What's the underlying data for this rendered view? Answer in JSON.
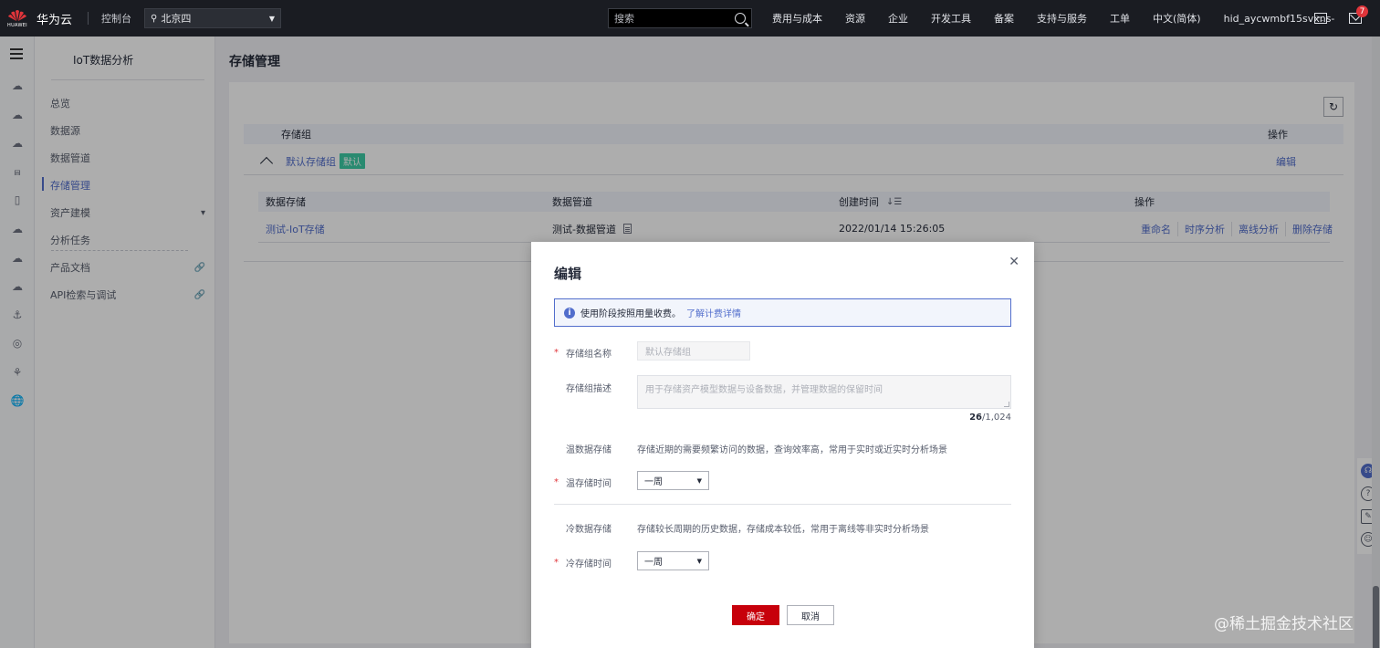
{
  "topbar": {
    "brand": "华为云",
    "logo_text": "HUAWEI",
    "console": "控制台",
    "region": "北京四",
    "search_placeholder": "搜索",
    "nav": [
      "费用与成本",
      "资源",
      "企业",
      "开发工具",
      "备案",
      "支持与服务",
      "工单",
      "中文(简体)",
      "hid_aycwmbf15svxns-"
    ],
    "mail_badge": "7"
  },
  "sidebar": {
    "title": "IoT数据分析",
    "items": [
      {
        "label": "总览"
      },
      {
        "label": "数据源"
      },
      {
        "label": "数据管道"
      },
      {
        "label": "存储管理",
        "active": true
      },
      {
        "label": "资产建模",
        "suffix": "▾"
      },
      {
        "label": "分析任务"
      },
      {
        "label": "产品文档",
        "suffix": "🔗"
      },
      {
        "label": "API检索与调试",
        "suffix": "🔗"
      }
    ]
  },
  "main": {
    "title": "存储管理",
    "outer_table": {
      "headers": [
        "存储组",
        "操作"
      ],
      "row": {
        "name": "默认存储组",
        "tag": "默认",
        "action": "编辑"
      }
    },
    "inner_table": {
      "headers": [
        "数据存储",
        "数据管道",
        "创建时间",
        "操作"
      ],
      "row": {
        "storage": "测试-IoT存储",
        "pipeline": "测试-数据管道",
        "created": "2022/01/14 15:26:05",
        "ops": [
          "重命名",
          "时序分析",
          "离线分析",
          "删除存储"
        ]
      }
    }
  },
  "dialog": {
    "title": "编辑",
    "notice_text": "使用阶段按照用量收费。",
    "notice_link": "了解计费详情",
    "fields": {
      "name_label": "存储组名称",
      "name_value": "默认存储组",
      "desc_label": "存储组描述",
      "desc_value": "用于存储资产模型数据与设备数据，并管理数据的保留时间",
      "counter_current": "26",
      "counter_max": "/1,024",
      "warm_label": "温数据存储",
      "warm_desc": "存储近期的需要频繁访问的数据，查询效率高，常用于实时或近实时分析场景",
      "warm_time_label": "温存储时间",
      "warm_time_value": "一周",
      "cold_label": "冷数据存储",
      "cold_desc": "存储较长周期的历史数据，存储成本较低，常用于离线等非实时分析场景",
      "cold_time_label": "冷存储时间",
      "cold_time_value": "一周"
    },
    "ok": "确定",
    "cancel": "取消"
  },
  "watermark": "@稀土掘金技术社区",
  "colors": {
    "accent": "#526ecc",
    "primary_button": "#c7000b",
    "tag_green": "#3dcca6",
    "topbar_bg": "#1a1c22"
  }
}
